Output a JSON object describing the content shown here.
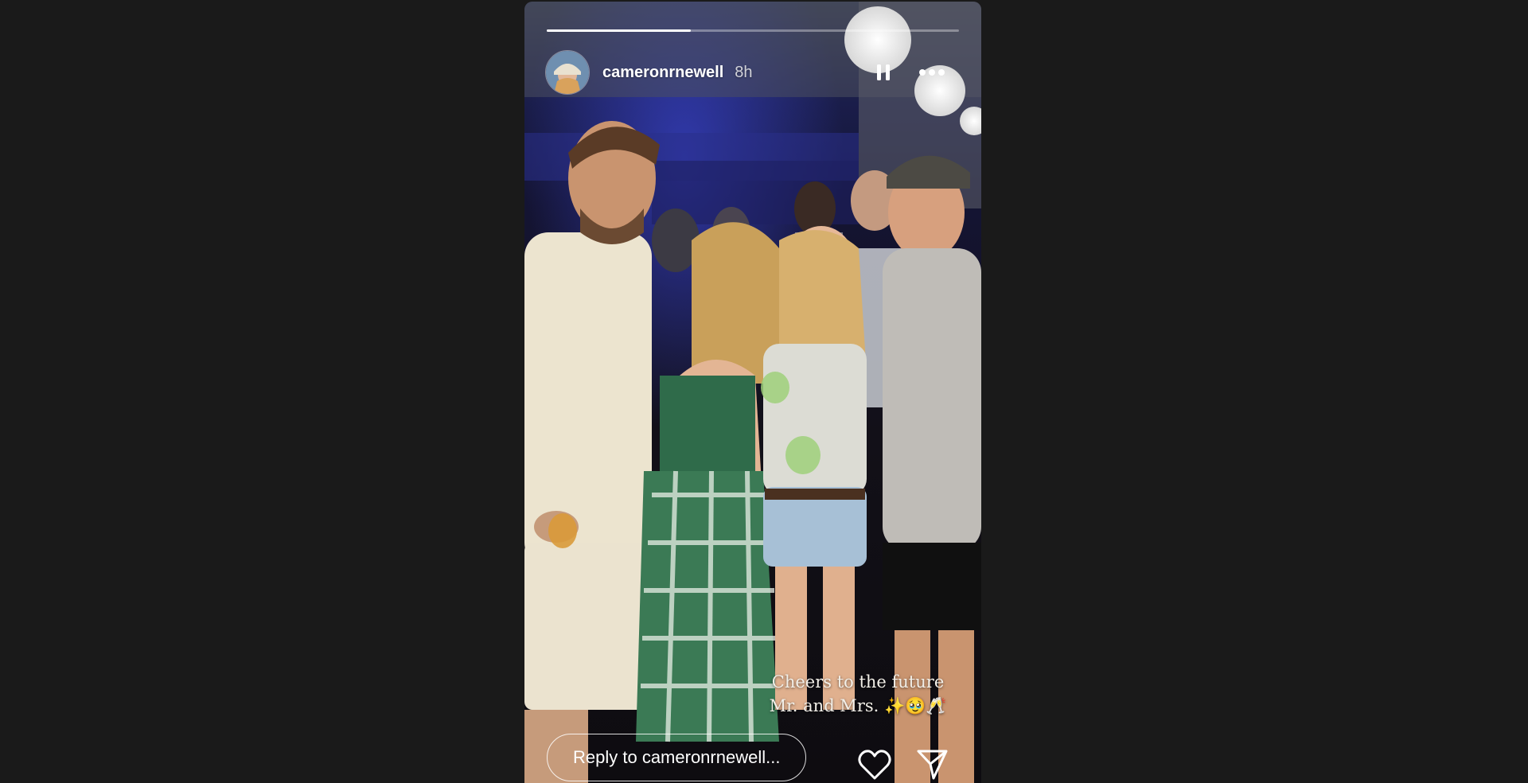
{
  "story": {
    "progress_fraction": 0.35,
    "username": "cameronrnewell",
    "timestamp": "8h",
    "caption_line1": "Cheers to the future",
    "caption_line2": "Mr. and Mrs. ✨🥹🥂",
    "photo_description_alt": ""
  },
  "controls": {
    "pause_icon": "pause-icon",
    "more_icon": "more-horizontal-icon",
    "like_icon": "heart-icon",
    "send_icon": "send-icon"
  },
  "reply": {
    "placeholder": "Reply to cameronrnewell..."
  },
  "colors": {
    "page_background": "#1a1a1a",
    "text": "#ffffff"
  }
}
